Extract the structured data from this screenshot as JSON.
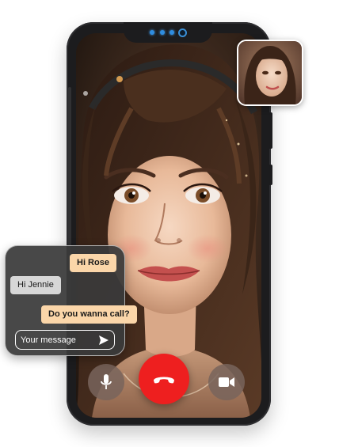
{
  "call": {
    "remote_video": "portrait-of-young-woman",
    "self_preview": "portrait-of-woman",
    "controls": {
      "mic_icon": "microphone-icon",
      "end_icon": "phone-hang-up-icon",
      "video_icon": "video-camera-icon"
    }
  },
  "chat": {
    "messages": [
      {
        "from": "me",
        "text": "Hi Rose"
      },
      {
        "from": "them",
        "text": "Hi Jennie"
      },
      {
        "from": "me",
        "text": "Do you wanna call?"
      }
    ],
    "input_placeholder": "Your message",
    "send_icon": "send-icon"
  },
  "colors": {
    "end_call": "#ee1f1f",
    "outgoing_bubble": "#fbd6a9",
    "incoming_bubble": "#d7d7d7",
    "chat_panel": "#3a3a3a",
    "camera_accent": "#2f8de0"
  }
}
